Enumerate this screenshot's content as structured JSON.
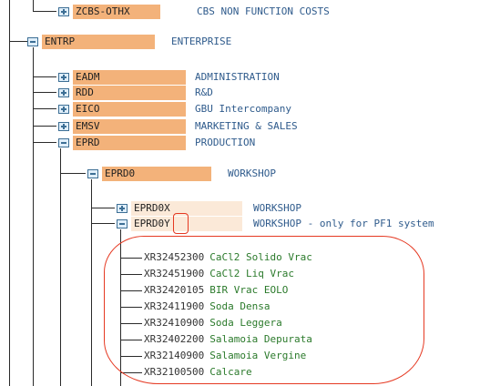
{
  "tree": {
    "top_row": {
      "code": "ZCBS-OTHX",
      "desc": "CBS NON FUNCTION COSTS",
      "state": "collapsed"
    },
    "entrp": {
      "code": "ENTRP",
      "desc": "ENTERPRISE",
      "state": "expanded"
    },
    "entrp_children": [
      {
        "code": "EADM",
        "desc": "ADMINISTRATION",
        "state": "collapsed"
      },
      {
        "code": "RDD",
        "desc": "R&D",
        "state": "collapsed"
      },
      {
        "code": "EICO",
        "desc": "GBU Intercompany",
        "state": "collapsed"
      },
      {
        "code": "EMSV",
        "desc": "MARKETING & SALES",
        "state": "collapsed"
      },
      {
        "code": "EPRD",
        "desc": "PRODUCTION",
        "state": "expanded"
      }
    ],
    "eprd0": {
      "code": "EPRD0",
      "desc": "WORKSHOP",
      "state": "expanded"
    },
    "eprd0_children": [
      {
        "code": "EPRD0X",
        "desc": "WORKSHOP",
        "state": "collapsed"
      },
      {
        "code": "EPRD0Y",
        "desc": "WORKSHOP - only for PF1 system",
        "state": "expanded"
      }
    ],
    "leaves": [
      {
        "code": "XR32452300",
        "desc": "CaCl2 Solido Vrac"
      },
      {
        "code": "XR32451900",
        "desc": "CaCl2 Liq Vrac"
      },
      {
        "code": "XR32420105",
        "desc": "BIR Vrac EOLO"
      },
      {
        "code": "XR32411900",
        "desc": "Soda Densa"
      },
      {
        "code": "XR32410900",
        "desc": "Soda Leggera"
      },
      {
        "code": "XR32402200",
        "desc": "Salamoia Depurata"
      },
      {
        "code": "XR32140900",
        "desc": "Salamoia Vergine"
      },
      {
        "code": "XR32100500",
        "desc": "Calcare"
      }
    ]
  },
  "colors": {
    "code_bg": "#f3b27a",
    "code_bg_light": "#fbe9d8",
    "desc_text": "#2f5b8c",
    "leaf_desc_text": "#2b7a2b",
    "annotation": "#e53922"
  },
  "icons": {
    "expanded": "tree-minus-icon",
    "collapsed": "tree-plus-icon"
  }
}
